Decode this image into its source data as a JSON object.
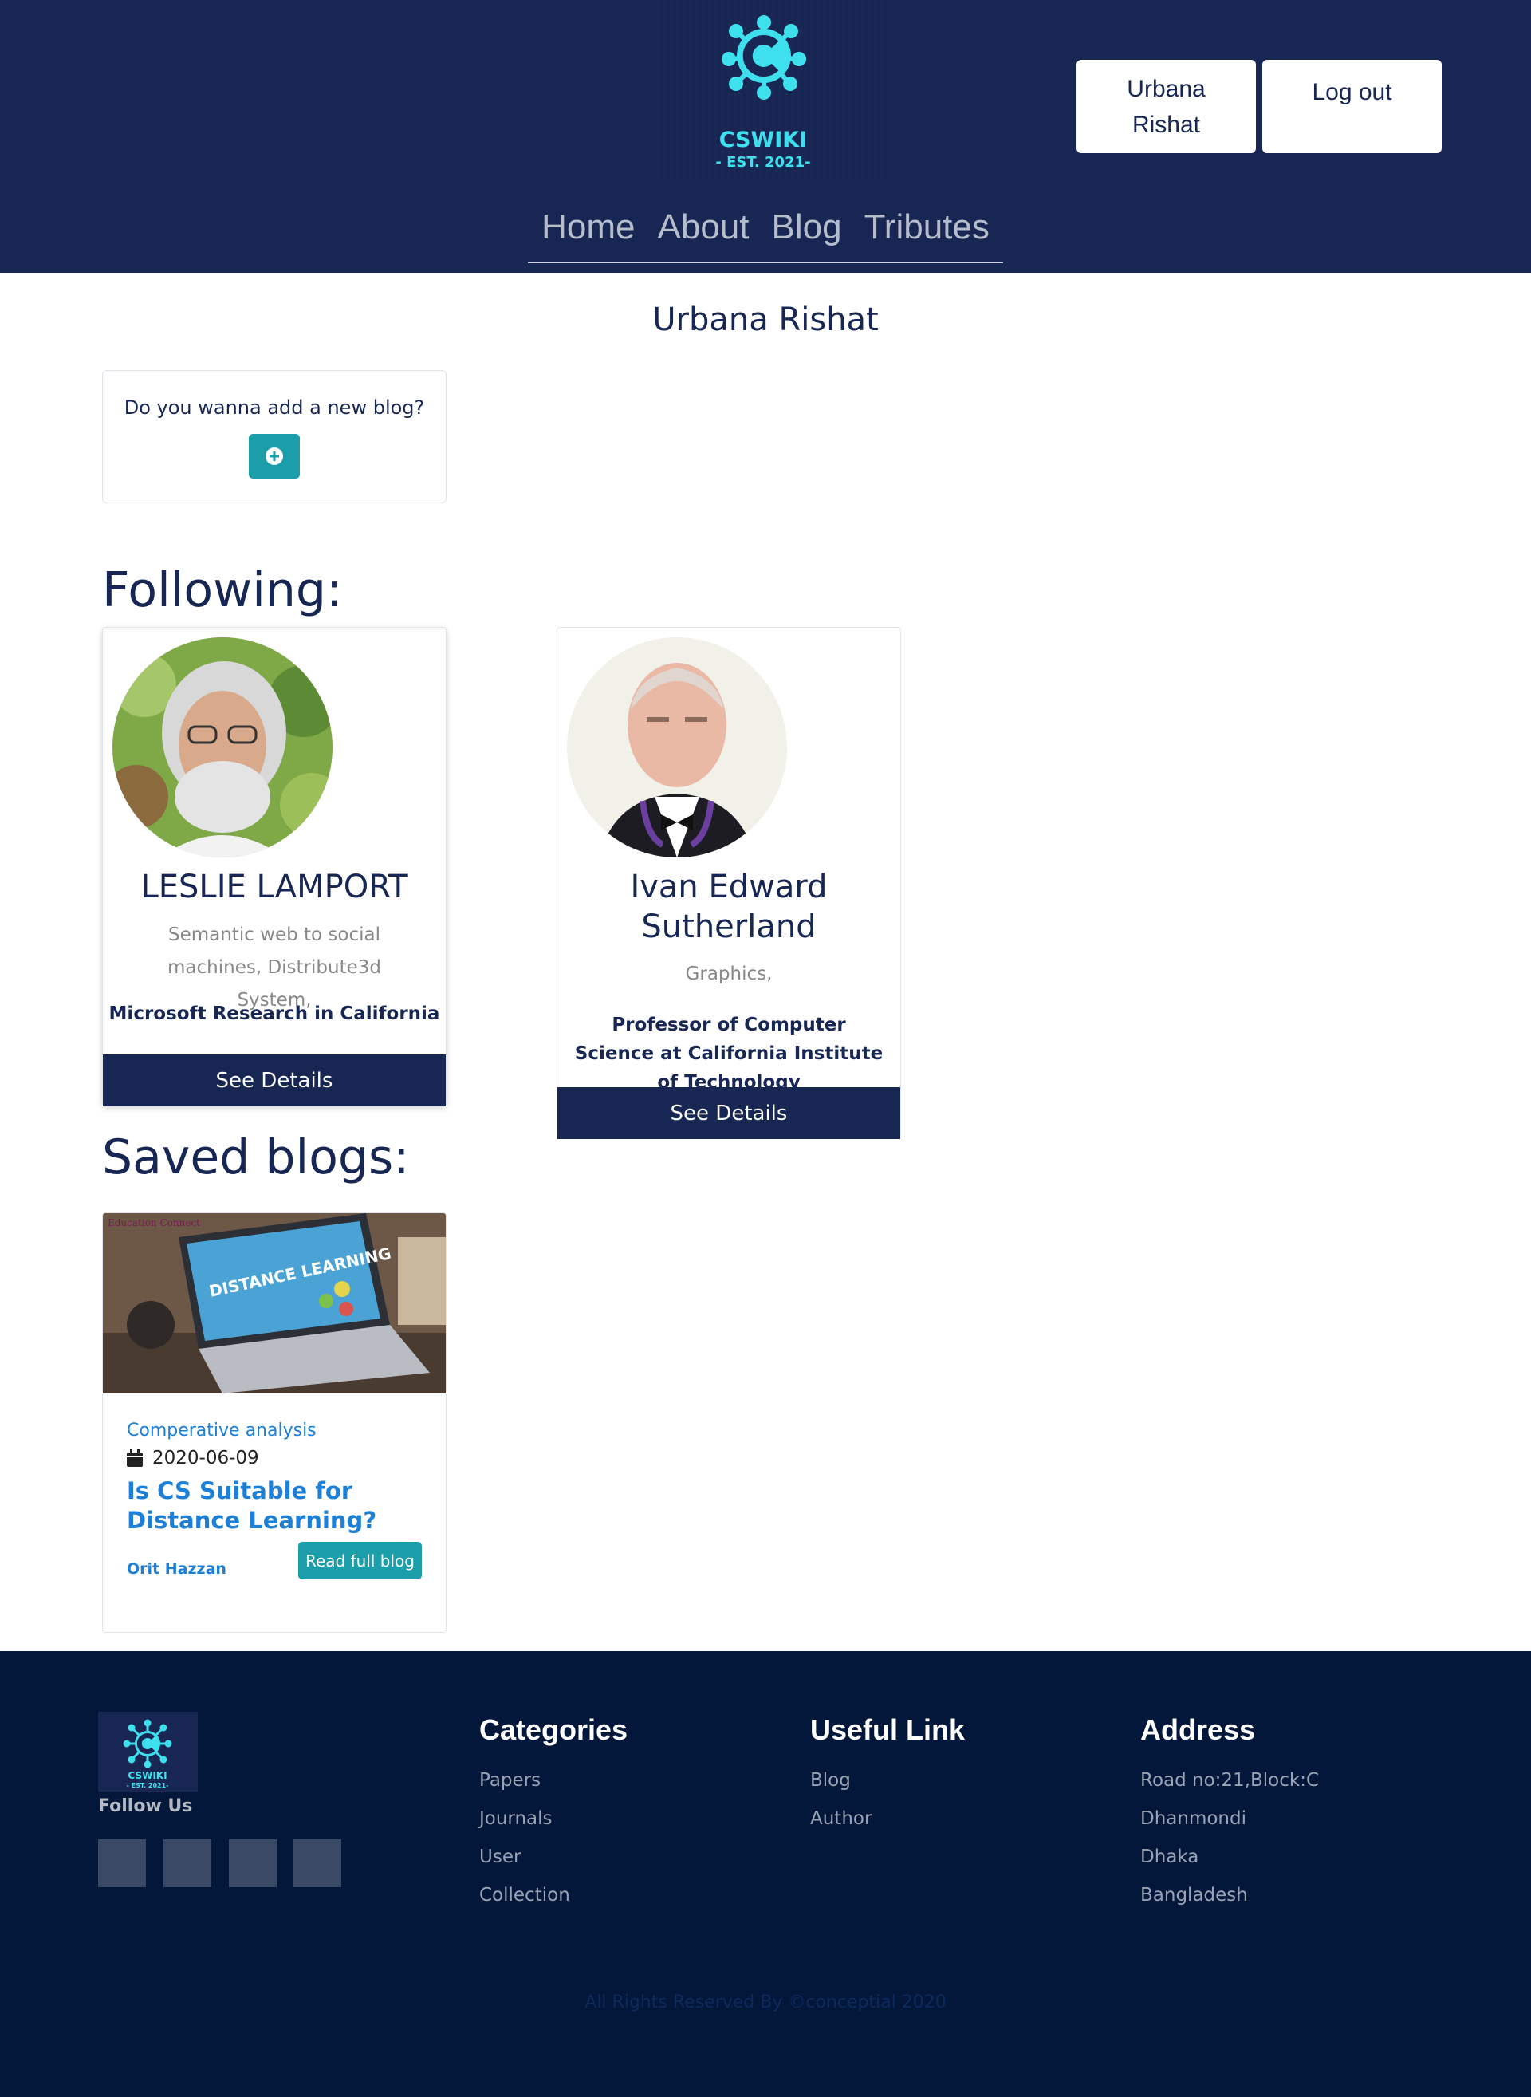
{
  "header": {
    "logo": {
      "text": "CSWIKI",
      "sub": "- EST. 2021-",
      "color": "#3fe0ee"
    },
    "user_button": "Urbana Rishat",
    "logout_button": "Log out",
    "nav": [
      "Home",
      "About",
      "Blog",
      "Tributes"
    ]
  },
  "page_title": "Urbana Rishat",
  "add_blog": {
    "question": "Do you wanna add a new blog?",
    "icon": "plus-circle-icon"
  },
  "following": {
    "heading": "Following:",
    "people": [
      {
        "name": "LESLIE LAMPORT",
        "fields": "Semantic web to social machines, Distribute3d System,",
        "affiliation": "Microsoft Research in California",
        "button": "See Details"
      },
      {
        "name": "Ivan Edward Sutherland",
        "fields": "Graphics,",
        "affiliation": "Professor of Computer Science at California Institute of Technology",
        "button": "See Details"
      }
    ]
  },
  "saved_blogs": {
    "heading": "Saved blogs:",
    "blogs": [
      {
        "image_text": "DISTANCE LEARNING",
        "image_brand": "Education Connect",
        "category": "Comperative analysis",
        "date": "2020-06-09",
        "title": "Is CS Suitable for Distance Learning?",
        "author": "Orit Hazzan",
        "button": "Read full blog"
      }
    ]
  },
  "footer": {
    "logo": {
      "text": "CSWIKI",
      "sub": "- EST. 2021-"
    },
    "follow_us": "Follow Us",
    "social_icons": [
      "facebook-icon",
      "twitter-icon",
      "instagram-icon",
      "linkedin-icon"
    ],
    "categories": {
      "title": "Categories",
      "items": [
        "Papers",
        "Journals",
        "User",
        "Collection"
      ]
    },
    "useful_link": {
      "title": "Useful Link",
      "items": [
        "Blog",
        "Author"
      ]
    },
    "address": {
      "title": "Address",
      "items": [
        "Road no:21,Block:C",
        "Dhanmondi",
        "Dhaka",
        "Bangladesh"
      ]
    },
    "copyright": "All Rights Reserved By ©conceptial 2020"
  },
  "colors": {
    "header_bg": "#172653",
    "footer_bg": "#021739",
    "accent_teal": "#1b9daa",
    "link_blue": "#1e7fd6"
  }
}
